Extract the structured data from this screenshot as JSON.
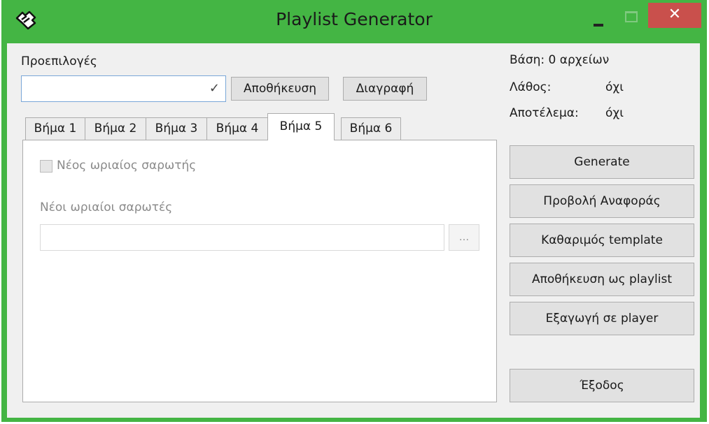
{
  "window": {
    "title": "Playlist Generator",
    "close_glyph": "✕",
    "icons": [
      "app-icon",
      "minimize-icon",
      "maximize-icon",
      "close-icon"
    ]
  },
  "presets": {
    "label": "Προεπιλογές",
    "selected": "",
    "save_label": "Αποθήκευση",
    "delete_label": "Διαγραφή"
  },
  "tabs": [
    {
      "label": "Βήμα 1",
      "active": false
    },
    {
      "label": "Βήμα 2",
      "active": false
    },
    {
      "label": "Βήμα 3",
      "active": false
    },
    {
      "label": "Βήμα 4",
      "active": false
    },
    {
      "label": "Βήμα 5",
      "active": true
    },
    {
      "label": "Βήμα 6",
      "active": false
    }
  ],
  "step5": {
    "checkbox_label": "Νέος ωριαίος σαρωτής",
    "checkbox_checked": false,
    "scanners_label": "Νέοι ωριαίοι σαρωτές",
    "scanners_value": "",
    "browse_label": "..."
  },
  "status": {
    "base": "Βάση: 0 αρχείων",
    "error_label": "Λάθος:",
    "error_value": "όχι",
    "result_label": "Αποτέλεμα:",
    "result_value": "όχι"
  },
  "actions": {
    "generate": "Generate",
    "view_report": "Προβολή Αναφοράς",
    "clear_template": "Καθαριμός template",
    "save_playlist": "Αποθήκευση ως playlist",
    "export_player": "Εξαγωγή σε player",
    "exit": "Έξοδος"
  }
}
